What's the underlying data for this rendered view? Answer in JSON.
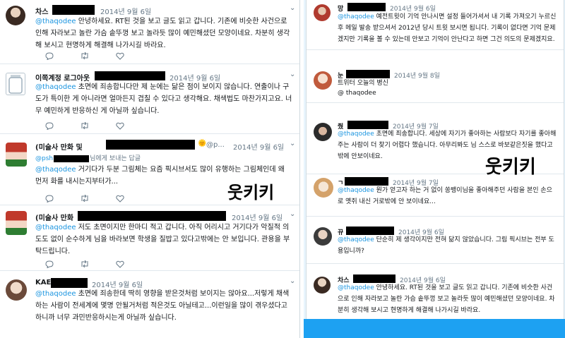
{
  "left": {
    "tweets": [
      {
        "name": "차스",
        "date": "2014년 9월 6일",
        "handle": "@thaqodee",
        "text": " 안녕하세요. RT된 것을 보고 글도 읽고 갑니다. 기존에 비슷한 사건으로 인해 자라보고 놀란 가슴 솥뚜껑 보고 놀라듯 많이 예민해셨던 모양이네요. 차분히 생각해 보시고 현명하게 해결해 나가시길 바라요."
      },
      {
        "name": "이쪽계정 로그아웃",
        "date": "2014년 9월 6일",
        "handle": "@thaqodee",
        "text": " 초면에 죄송합니다만 제 눈에는 닮은 점이 보이지 않습니다. 연출이나 구도가 특이한 게 아니라면 얼마든지 겹칠 수 있다고 생각해요. 채색법도 마찬가지고요. 너무 예민하게 반응하신 게 아닐까 싶습니다."
      },
      {
        "name": "(미술사 만화 및",
        "date": "2014년 9월 6일",
        "handle_top": "@psh",
        "reply_suffix": "님에게 보내는 답글",
        "handle": "@thaqodee",
        "text": " 거기다가 두분 그림체는 요즘 픽시브서도 많이 유행하는 그림체인데 왜 먼저 화를 내시는지부터가...",
        "chip": "@p..."
      },
      {
        "name": "(미술사 만화",
        "date": "2014년 9월 6일",
        "handle": "@thaqodee",
        "text": " 저도 초면이지만 한마디 적고 갑니다. 아직 어리시고 거기다가 악질적 의도도 없이 순수하게 님을 바라보면 학생을 질밥고 있다고밖에는 안 보입니다. 관용을 부탁드립니다."
      },
      {
        "name": "KAE",
        "date": "2014년 9월 6일",
        "handle": "@thaqodee",
        "text": " 초면에 죄송한데 딱히 영향을 받은것처럼 보이지는 않아요...저렇게 채색하는 사람이 전세계에 몇명 안될거처럼 적은것도 아닐테고...이런일을 많이 겪우셨다고 하니까 너무 과민반응하시는게 아닐까 싶습니다."
      }
    ],
    "overlay_text": "웃키키"
  },
  "right": {
    "tweets": [
      {
        "name": "망",
        "date": "2014년 9월 6일",
        "handle": "@thaqodee",
        "text": " 예전트윗이 기억 안나시면 설정 들어가셔서 내 기록 가져오기 누르신후 메일 발송 받으셔서 2012년 당시 트윗 보시면 됩니다. 기록이 없다면 기억 문제겠지만 기록을 볼 수 있는데 안보고 기억이 안난다고 하면 그건 의도의 문제겠지요."
      },
      {
        "name": "눈",
        "date": "2014년 9월 8일",
        "text": "트위터 오늘의 병신",
        "handle": "@ thaqodee"
      },
      {
        "name": "줬",
        "date": "2014년 9월 7일",
        "handle": "@thaqodee",
        "text": " 초면에 죄송합니다. 세상에 자기가 좋아하는 사람보다 자기를 좋아해주는 사람이 더 찾기 어렵다 했습니다. 아무리봐도 님 스스로 바보같은짓을 했다고밖에 안보이네요."
      },
      {
        "name": "ㄱ",
        "date": "2014년 9월 7일",
        "handle": "@thaqodee",
        "text": " 뭔가 얻고자 하는 거 없이 쏭뱅이님을 좋아해주던 사람을 본인 손으로 옛쥐 내신 거로밖에 안 보이네요..."
      },
      {
        "name": "뀨",
        "date": "2014년 9월 6일",
        "handle": "@thaqodee",
        "text": " 단순히 제 생각이지만 전혀 닮지 않았습니다. 그림 픽시브는 전부 도용입니까?"
      },
      {
        "name": "차스",
        "date": "2014년 9월 6일",
        "handle": "@thaqodee",
        "text": " 안녕하세요. RT된 것을 보고 글도 읽고 갑니다. 기존에 비슷한 사건으로 인해 자라보고 놀란 가슴 솥뚜껑 보고 놀라듯 많이 예민해셨던 모양이네요. 차분히 생각해 보시고 현명하게 해결해 나가시길 바라요."
      }
    ],
    "overlay_text": "웃키키"
  },
  "colors": {
    "link": "#1b95e0",
    "muted": "#657786",
    "accent_bar": "#1da1f2"
  }
}
